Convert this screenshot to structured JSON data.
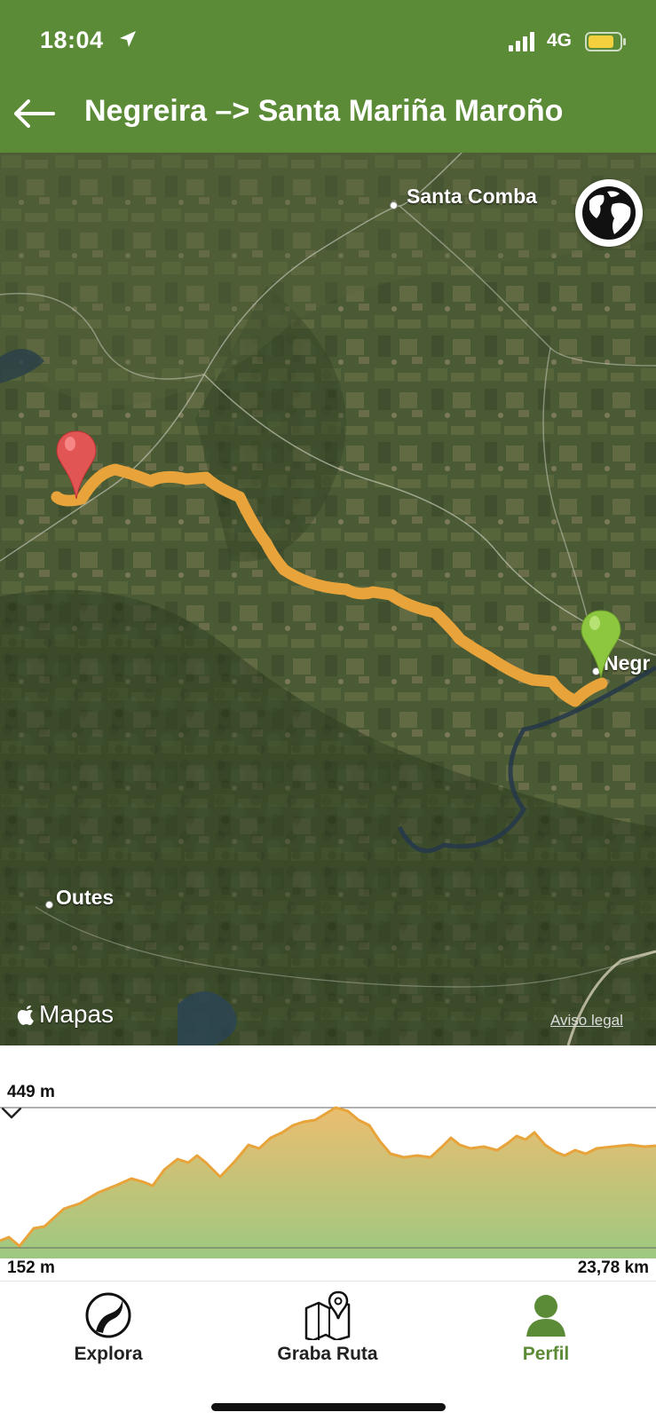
{
  "status_bar": {
    "time": "18:04",
    "network": "4G",
    "battery_color": "#f4d03f"
  },
  "header": {
    "title": "Negreira –> Santa Mariña Maroño",
    "bg_color": "#5b8b37"
  },
  "map": {
    "places": [
      {
        "name": "Santa Comba"
      },
      {
        "name": "Negr"
      },
      {
        "name": "Outes"
      }
    ],
    "brand": "Mapas",
    "legal_link": "Aviso legal",
    "route_color": "#e8a33a",
    "start_pin_color": "#e25555",
    "end_pin_color": "#8dc63f"
  },
  "elevation": {
    "max_label": "449 m",
    "min_label": "152 m",
    "distance_label": "23,78 km",
    "profile_color": "#e8a33a"
  },
  "tabbar": {
    "tabs": [
      {
        "label": "Explora",
        "icon": "explora-swirl-icon",
        "active": false
      },
      {
        "label": "Graba Ruta",
        "icon": "map-pin-icon",
        "active": false
      },
      {
        "label": "Perfil",
        "icon": "profile-user-icon",
        "active": true
      }
    ],
    "active_color": "#5b8b37"
  }
}
